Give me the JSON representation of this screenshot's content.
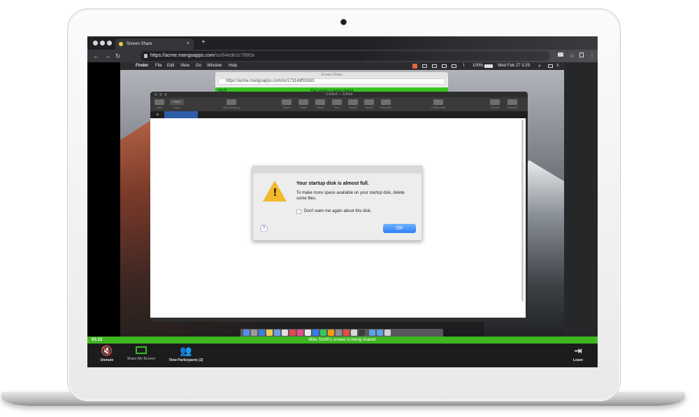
{
  "browser": {
    "tab_title": "Screen Share",
    "tab_close": "×",
    "new_tab": "+",
    "url_host": "https://acme.mangoapps.com",
    "url_path": "/ss/64ede1c7680a",
    "back": "←",
    "forward": "→",
    "reload": "↻",
    "star": "☆",
    "menu": "⋮"
  },
  "mac_menu": {
    "apple": "",
    "items": [
      "Finder",
      "File",
      "Edit",
      "View",
      "Go",
      "Window",
      "Help"
    ],
    "battery": "100%",
    "clock": "Wed Feb 27  3:29"
  },
  "back_window": {
    "title": "Screen Share",
    "url": "https://acme.mangoapps.com/ss/17314df91b53",
    "timer": "03:22",
    "status": "Your screen is being shared"
  },
  "keynote": {
    "title": "Untitled — Edited",
    "toolbar": [
      "View",
      "Zoom",
      "Add Category",
      "Insert",
      "Table",
      "Chart",
      "Text",
      "Shape",
      "Media",
      "Comment",
      "Collaborate",
      "Format",
      "Organize"
    ],
    "zoom_value": "125%",
    "add_tab": "+"
  },
  "alert": {
    "title": "Your startup disk is almost full.",
    "message": "To make more space available on your startup disk, delete some files.",
    "checkbox_label": "Don't warn me again about this disk.",
    "ok_label": "OK",
    "help_label": "?",
    "warning_mark": "!"
  },
  "share_bar": {
    "timer": "03:22",
    "message": "Mike Smith's screen is being shared."
  },
  "controls": {
    "unmute": "Unmute",
    "share_screen": "Share My Screen",
    "participants": "View Participants (2)",
    "leave": "Leave"
  },
  "colors": {
    "share_green": "#3fb621",
    "ok_blue": "#2f7ff2",
    "warning_yellow": "#f2b92b"
  }
}
